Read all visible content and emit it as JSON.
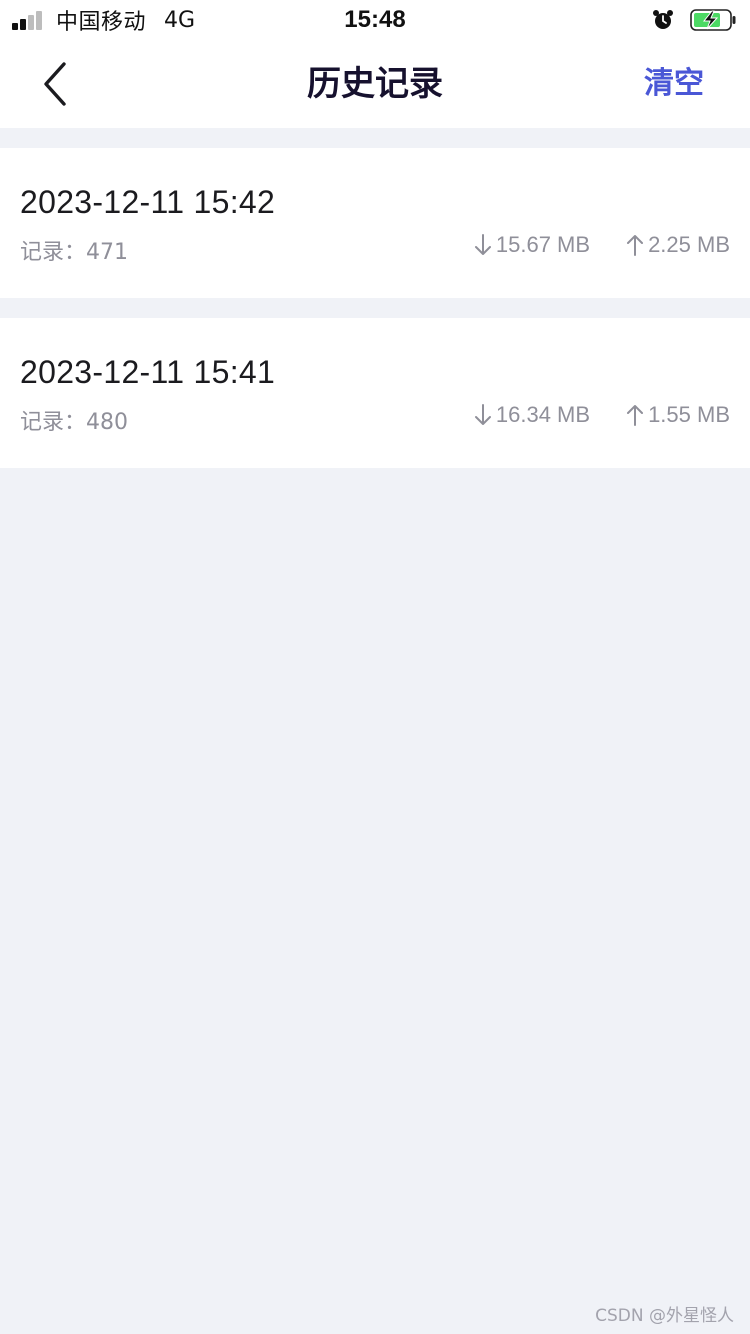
{
  "status_bar": {
    "carrier": "中国移动",
    "network": "4G",
    "time": "15:48",
    "icons": [
      "signal-icon",
      "alarm-icon",
      "battery-charging-icon"
    ]
  },
  "nav": {
    "title": "历史记录",
    "clear_label": "清空",
    "back_icon": "chevron-left-icon",
    "accent_color": "#4a57d6"
  },
  "records": [
    {
      "time": "2023-12-11 15:42",
      "count_text": "记录：471",
      "download": "15.67 MB",
      "upload": "2.25 MB"
    },
    {
      "time": "2023-12-11 15:41",
      "count_text": "记录：480",
      "download": "16.34 MB",
      "upload": "1.55 MB"
    }
  ],
  "watermark": "CSDN @外星怪人"
}
